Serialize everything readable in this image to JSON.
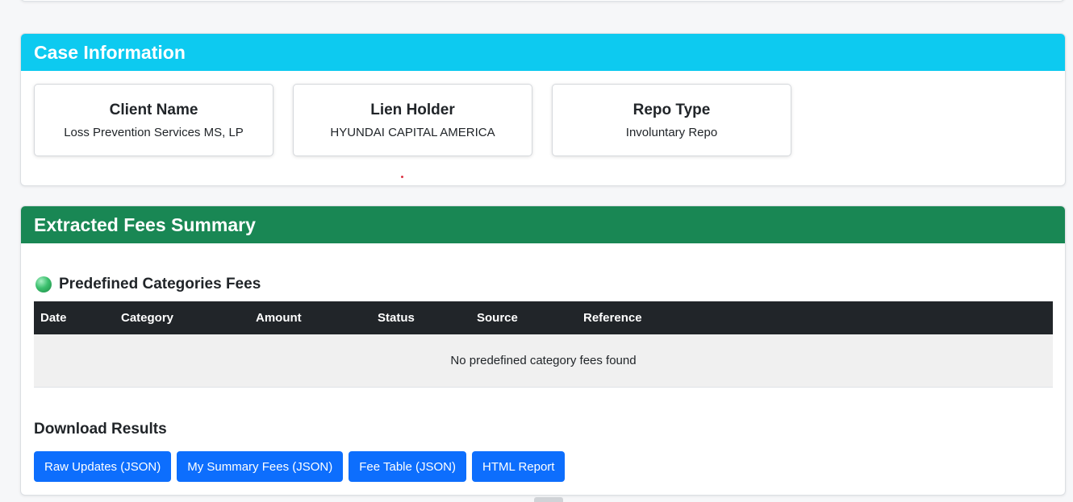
{
  "case_info": {
    "header": "Case Information",
    "boxes": [
      {
        "title": "Client Name",
        "value": "Loss Prevention Services MS, LP"
      },
      {
        "title": "Lien Holder",
        "value": "HYUNDAI CAPITAL AMERICA"
      },
      {
        "title": "Repo Type",
        "value": "Involuntary Repo"
      }
    ]
  },
  "fees_summary": {
    "header": "Extracted Fees Summary",
    "section_title": "Predefined Categories Fees",
    "columns": [
      "Date",
      "Category",
      "Amount",
      "Status",
      "Source",
      "Reference"
    ],
    "empty_message": "No predefined category fees found",
    "download_title": "Download Results",
    "buttons": [
      "Raw Updates (JSON)",
      "My Summary Fees (JSON)",
      "Fee Table (JSON)",
      "HTML Report"
    ]
  },
  "colors": {
    "info_header": "#0dcaf0",
    "success_header": "#198754",
    "primary_button": "#0d6efd",
    "table_header": "#212529"
  }
}
